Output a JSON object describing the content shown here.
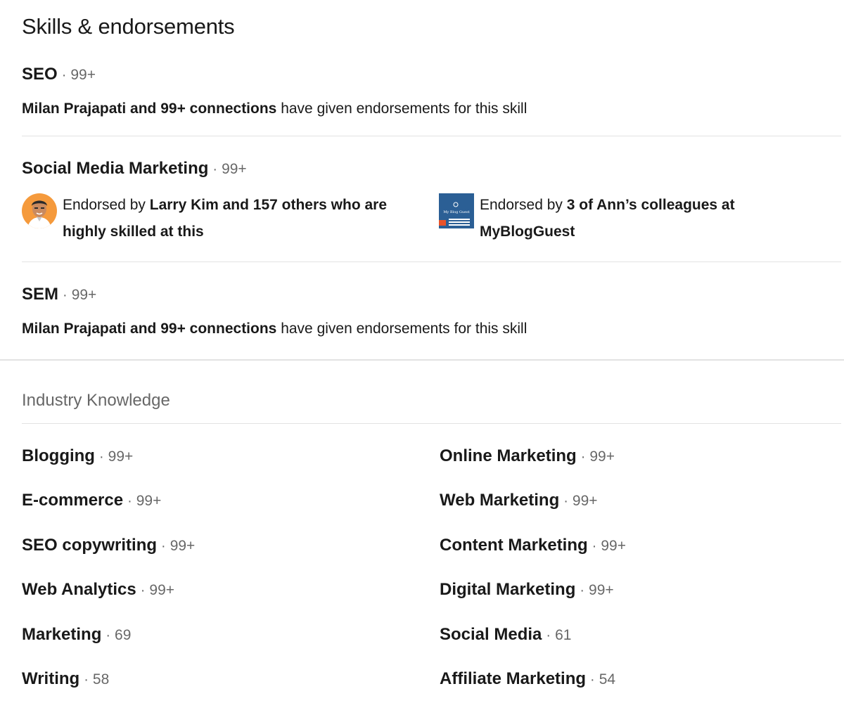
{
  "section": {
    "title": "Skills & endorsements"
  },
  "top_skills": [
    {
      "name": "SEO",
      "count": "99+",
      "endorse_bold": "Milan Prajapati and 99+ connections",
      "endorse_rest": " have given endorsements for this skill"
    },
    {
      "name": "Social Media Marketing",
      "count": "99+",
      "endorser_a": {
        "prefix": "Endorsed by ",
        "bold": "Larry Kim and 157 others who are highly skilled at this",
        "icon": "person-avatar"
      },
      "endorser_b": {
        "prefix": "Endorsed by ",
        "bold": "3 of Ann’s colleagues at MyBlogGuest",
        "icon": "company-logo",
        "logo_text": "My Blog Guest"
      }
    },
    {
      "name": "SEM",
      "count": "99+",
      "endorse_bold": "Milan Prajapati and 99+ connections",
      "endorse_rest": " have given endorsements for this skill"
    }
  ],
  "industry": {
    "heading": "Industry Knowledge",
    "left": [
      {
        "name": "Blogging",
        "count": "99+"
      },
      {
        "name": "E-commerce",
        "count": "99+"
      },
      {
        "name": "SEO copywriting",
        "count": "99+"
      },
      {
        "name": "Web Analytics",
        "count": "99+"
      },
      {
        "name": "Marketing",
        "count": "69"
      },
      {
        "name": "Writing",
        "count": "58"
      }
    ],
    "right": [
      {
        "name": "Online Marketing",
        "count": "99+"
      },
      {
        "name": "Web Marketing",
        "count": "99+"
      },
      {
        "name": "Content Marketing",
        "count": "99+"
      },
      {
        "name": "Digital Marketing",
        "count": "99+"
      },
      {
        "name": "Social Media",
        "count": "61"
      },
      {
        "name": "Affiliate Marketing",
        "count": "54"
      }
    ]
  },
  "separator": "·",
  "colors": {
    "text": "#1f1f1f",
    "muted": "#666666",
    "divider": "#e2e2e2",
    "avatar_bg": "#f59a3c",
    "logo_bg": "#2b5f95"
  }
}
